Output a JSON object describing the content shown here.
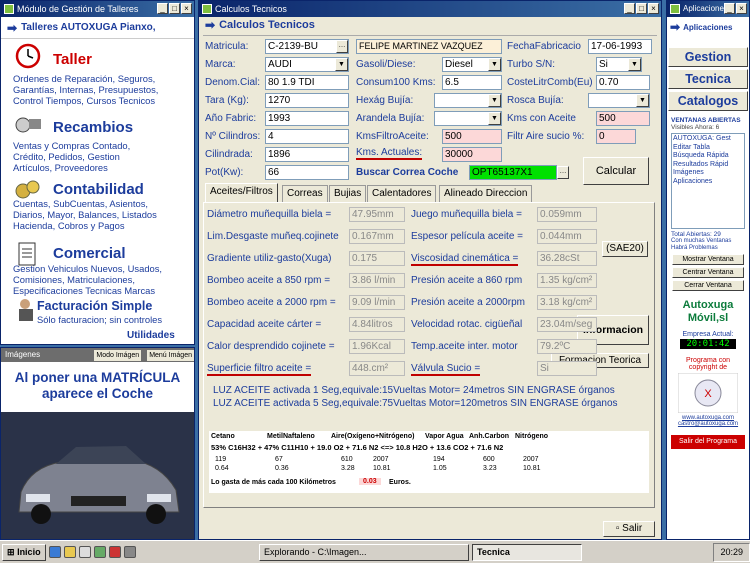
{
  "left": {
    "title": "Módulo de Gestión de Talleres",
    "header": "Talleres AUTOXUGA Pianxo,",
    "modules": [
      {
        "name": "Taller",
        "desc": [
          "Ordenes de Reparación, Seguros,",
          "Garantías, Internas, Presupuestos,",
          "Control Tiempos, Cursos Tecnicos"
        ]
      },
      {
        "name": "Recambios",
        "desc": [
          "Ventas y Compras Contado,",
          "Crédito, Pedidos,  Gestion",
          "Artículos, Proveedores"
        ]
      },
      {
        "name": "Contabilidad",
        "desc": [
          "Cuentas, SubCuentas, Asientos,",
          "Diarios, Mayor, Balances, Listados",
          "Hacienda, Cobros y Pagos"
        ]
      },
      {
        "name": "Comercial",
        "desc": [
          "Gestion Vehiculos Nuevos, Usados,",
          "Comisiones, Matriculaciones,",
          "Especificaciones Tecnicas Marcas"
        ]
      }
    ],
    "simple_title": "Facturación Simple",
    "simple_desc": "Sólo facturacion; sin controles",
    "utilidades": "Utilidades"
  },
  "images": {
    "title": "Imágenes",
    "mode1": "Modo Imágen",
    "mode2": "Menú Imágen",
    "caption": "Al poner una MATRÍCULA aparece el Coche"
  },
  "main": {
    "title": "Calculos Tecnicos",
    "subtitle": "Calculos Tecnicos",
    "fields": {
      "matricula_l": "Matricula:",
      "matricula": "C-2139-BU",
      "owner": "FELIPE MARTINEZ VAZQUEZ",
      "fecha_l": "FechaFabricacio",
      "fecha": "17-06-1993",
      "marca_l": "Marca:",
      "marca": "AUDI",
      "gasoil_l": "Gasoli/Diese:",
      "gasoil": "Diesel",
      "turbo_l": "Turbo S/N:",
      "turbo": "Si",
      "denom_l": "Denom.Cial:",
      "denom": "80 1.9 TDI",
      "consum_l": "Consum100 Kms:",
      "consum": "6.5",
      "coste_l": "CosteLitrComb(Eu)",
      "coste": "0.70",
      "tara_l": "Tara (Kg):",
      "tara": "1270",
      "hexag_l": "Hexág Bujía:",
      "rosca_l": "Rosca Bujía:",
      "anio_l": "Año Fabric:",
      "anio": "1993",
      "arandela_l": "Arandela Bujía:",
      "kmsac_l": "Kms con Aceite",
      "kmsac": "500",
      "cil_l": "Nº Cilindros:",
      "cil": "4",
      "kmsf_l": "KmsFiltroAceite:",
      "kmsf": "500",
      "filtr_l": "Filtr Aire sucio %:",
      "filtr": "0",
      "cilin_l": "Cilindrada:",
      "cilin": "1896",
      "kmsact_l": "Kms. Actuales:",
      "kmsact": "30000",
      "pot_l": "Pot(Kw):",
      "pot": "66",
      "buscar_l": "Buscar Correa Coche",
      "buscar": "OPT65137X1"
    },
    "calcular": "Calcular",
    "tabs": [
      "Aceites/Filtros",
      "Correas",
      "Bujias",
      "Calentadores",
      "Alineado Direccion"
    ],
    "left_rows": [
      {
        "l": "Diámetro muñequilla biela =",
        "v": "47.95mm"
      },
      {
        "l": "Lim.Desgaste muñeq.cojinete",
        "v": "0.167mm"
      },
      {
        "l": "Gradiente utiliz-gasto(Xuga)",
        "v": "0.175"
      },
      {
        "l": "Bombeo aceite a 850 rpm =",
        "v": "3.86 l/min"
      },
      {
        "l": "Bombeo aceite a 2000 rpm =",
        "v": "9.09 l/min"
      },
      {
        "l": "Capacidad aceite cárter =",
        "v": "4.84litros"
      },
      {
        "l": "Calor desprendido cojinete =",
        "v": "1.96Kcal"
      },
      {
        "l": "Superficie filtro aceite =",
        "v": "448.cm²"
      }
    ],
    "right_rows": [
      {
        "l": "Juego muñequilla biela =",
        "v": "0.059mm"
      },
      {
        "l": "Espesor película aceite =",
        "v": "0.044mm"
      },
      {
        "l": "Viscosidad cinemática =",
        "v": "36.28cSt"
      },
      {
        "l": "Presión aceite a 860 rpm",
        "v": "1.35 kg/cm²"
      },
      {
        "l": "Presión aceite a 2000rpm",
        "v": "3.18 kg/cm²"
      },
      {
        "l": "Velocidad rotac. cigüeñal",
        "v": "23.04m/seg"
      },
      {
        "l": "Temp.aceite inter. motor",
        "v": "79.2ºC"
      },
      {
        "l": "Válvula Sucio =",
        "v": "Si"
      }
    ],
    "sae": "(SAE20)",
    "informacion": "Informacion",
    "formacion": "Formacion Teorica",
    "luz1": "LUZ ACEITE activada 1 Seg,equivale:15Vueltas Motor= 24metros SIN ENGRASE órganos",
    "luz2": "LUZ ACEITE activada 5 Seg,equivale:75Vueltas Motor=120metros SIN ENGRASE órganos",
    "chem": {
      "h1": "Cetano",
      "h2": "MetilNaftaleno",
      "h3": "Aire(Oxígeno+Nitrógeno)",
      "h4": "Vapor Agua",
      "h5": "Anh.Carbon",
      "h6": "Nitrógeno",
      "eq": "53% C16H32 + 47% C11H10 + 19.0 O2 + 71.6 N2  <=>  10.8 H2O + 13.6 CO2 + 71.6 N2",
      "n1": [
        "119",
        "67",
        "610",
        "2007",
        "194",
        "600",
        "2007"
      ],
      "n2": [
        "0.64",
        "0.36",
        "3.28",
        "10.81",
        "1.05",
        "3.23",
        "10.81"
      ],
      "foot": "Lo gasta de más cada 100 Kilómetros",
      "foot_v": "0.03",
      "foot_u": "Euros."
    },
    "salir": "Salir"
  },
  "right": {
    "title": "Aplicaciones",
    "sub": "Aplicaciones",
    "b1": "Gestion",
    "b2": "Tecnica",
    "b3": "Catalogos",
    "ventanas": "VENTANAS ABIERTAS",
    "visibles": "Visibles Ahora: 6",
    "apps": [
      "AUTOXUGA: Gest",
      "Editar Tabla",
      "Búsqueda Rápida",
      "Resultados Rápid",
      "Imágenes",
      "Aplicaciones"
    ],
    "total": "Total Abiertas: 29",
    "con": "Con muchas Ventanas Habrá Problemas",
    "mostrar": "Mostrar Ventana",
    "centrar": "Centrar Ventana",
    "cerrar": "Cerrar Ventana",
    "brand1": "Autoxuga",
    "brand2": "Móvil,sl",
    "empresa": "Empresa Actual:",
    "clock": "20:01:42",
    "prog": "Programa con copyright de",
    "web": "www.autoxuga.com",
    "mail": "castro@autoxuga.com",
    "salirp": "Salir del Programa"
  },
  "taskbar": {
    "start": "Inicio",
    "t1": "Explorando - C:\\Imagen...",
    "t2": "Tecnica",
    "time": "20:29"
  }
}
